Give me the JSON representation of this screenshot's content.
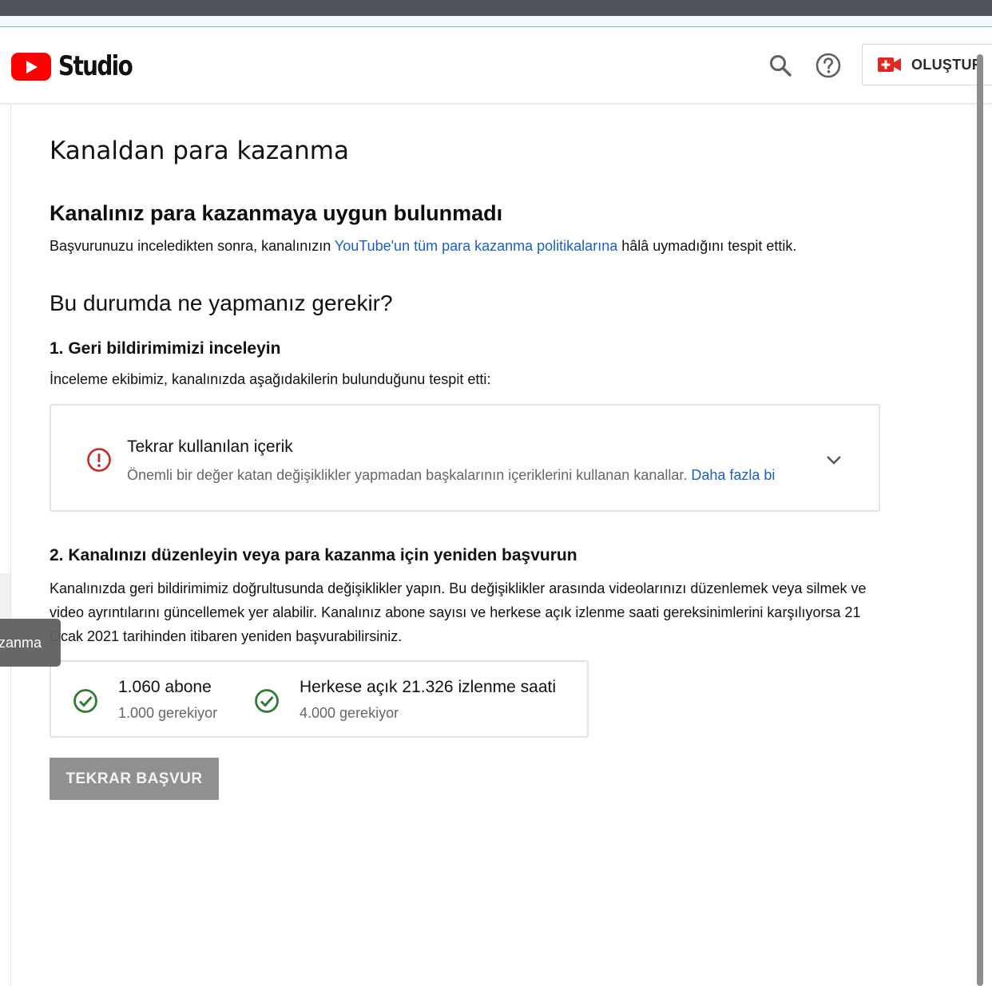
{
  "header": {
    "logo_text": "Studio",
    "search_icon": "search-icon",
    "help_icon": "help-circle-icon",
    "create_label": "OLUŞTUR",
    "create_icon": "video-plus-icon",
    "brand_color": "#ff0000"
  },
  "main": {
    "page_title": "Kanaldan para kazanma",
    "status_heading": "Kanalınız para kazanmaya uygun bulunmadı",
    "status_text_before": "Başvurunuzu inceledikten sonra, kanalınızın ",
    "status_link": "YouTube'un tüm para kazanma politikalarına",
    "status_text_after": " hâlâ uymadığını tespit ettik.",
    "what_heading": "Bu durumda ne yapmanız gerekir?",
    "step1_heading": "1. Geri bildirimimizi inceleyin",
    "step1_text": "İnceleme ekibimiz, kanalınızda aşağıdakilerin bulunduğunu tespit etti:",
    "issue": {
      "icon": "alert-circle-icon",
      "title": "Tekrar kullanılan içerik",
      "description": "Önemli bir değer katan değişiklikler yapmadan başkalarının içeriklerini kullanan kanallar. ",
      "learn_more": "Daha fazla bi",
      "expand_icon": "chevron-down-icon"
    },
    "step2_heading": "2. Kanalınızı düzenleyin veya para kazanma için yeniden başvurun",
    "step2_text": "Kanalınızda geri bildirimimiz doğrultusunda değişiklikler yapın. Bu değişiklikler arasında videolarınızı düzenlemek veya silmek ve video ayrıntılarını güncellemek yer alabilir. Kanalınız abone sayısı ve herkese açık izlenme saati gereksinimlerini karşılıyorsa 21 Ocak 2021 tarihinden itibaren yeniden başvurabilirsiniz.",
    "requirements": [
      {
        "icon": "check-circle-icon",
        "value": "1.060 abone",
        "required": "1.000 gerekiyor"
      },
      {
        "icon": "check-circle-icon",
        "value": "Herkese açık 21.326 izlenme saati",
        "required": "4.000 gerekiyor"
      }
    ],
    "apply_button": "TEKRAR BAŞVUR"
  },
  "sidebar": {
    "tooltip_text": "zanma"
  },
  "colors": {
    "link": "#1a5fcc",
    "error": "#c62828",
    "success": "#2e7d32",
    "button_disabled": "#909090"
  }
}
